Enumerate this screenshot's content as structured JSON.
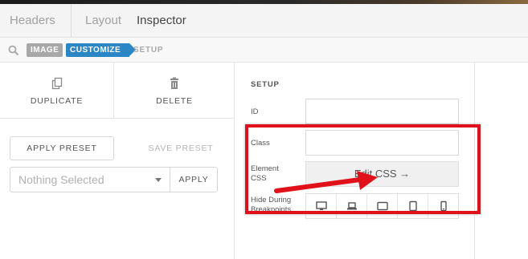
{
  "tabs": [
    {
      "label": "Headers"
    },
    {
      "label": "Layout"
    },
    {
      "label": "Inspector"
    }
  ],
  "breadcrumb": {
    "image": "IMAGE",
    "customize": "CUSTOMIZE",
    "setup": "SETUP"
  },
  "actions": {
    "duplicate": "DUPLICATE",
    "delete": "DELETE"
  },
  "preset": {
    "apply_preset": "APPLY PRESET",
    "save_preset": "SAVE PRESET",
    "select_value": "Nothing Selected",
    "apply": "APPLY"
  },
  "setup": {
    "title": "SETUP",
    "id_label": "ID",
    "id_value": "",
    "class_label": "Class",
    "class_value": "",
    "css_label": "Element CSS",
    "edit_css": "Edit CSS →",
    "hide_label": "Hide During Breakpoints",
    "breakpoints": [
      "desktop-icon",
      "laptop-icon",
      "tablet-landscape-icon",
      "tablet-portrait-icon",
      "phone-icon"
    ]
  },
  "colors": {
    "accent": "#2a86c4",
    "highlight": "#e0111b"
  }
}
